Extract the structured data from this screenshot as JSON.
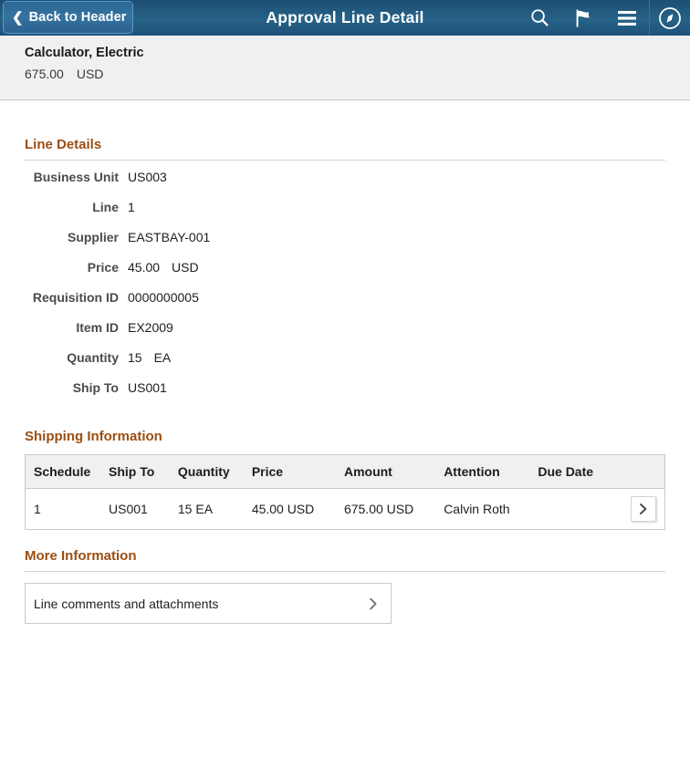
{
  "appbar": {
    "back_label": "Back to Header",
    "back_chevron": "chevron-left-icon",
    "title": "Approval Line Detail",
    "icons": [
      {
        "name": "search-icon",
        "label": "Search"
      },
      {
        "name": "flag-icon",
        "label": "Notifications"
      },
      {
        "name": "hamburger-menu-icon",
        "label": "Actions Menu"
      },
      {
        "name": "nav-compass-icon",
        "label": "NavBar"
      }
    ]
  },
  "subheader": {
    "item_title": "Calculator, Electric",
    "amount": "675.00",
    "currency": "USD"
  },
  "line_details": {
    "heading": "Line Details",
    "fields": [
      {
        "label": "Business Unit",
        "value": "US003",
        "unit": ""
      },
      {
        "label": "Line",
        "value": "1",
        "unit": ""
      },
      {
        "label": "Supplier",
        "value": "EASTBAY-001",
        "unit": ""
      },
      {
        "label": "Price",
        "value": "45.00",
        "unit": "USD"
      },
      {
        "label": "Requisition ID",
        "value": "0000000005",
        "unit": ""
      },
      {
        "label": "Item ID",
        "value": "EX2009",
        "unit": ""
      },
      {
        "label": "Quantity",
        "value": "15",
        "unit": "EA"
      },
      {
        "label": "Ship To",
        "value": "US001",
        "unit": ""
      }
    ]
  },
  "shipping_information": {
    "heading": "Shipping Information",
    "columns": [
      "Schedule",
      "Ship To",
      "Quantity",
      "Price",
      "Amount",
      "Attention",
      "Due Date",
      ""
    ],
    "rows": [
      {
        "schedule": "1",
        "ship_to": "US001",
        "quantity": "15 EA",
        "price": "45.00 USD",
        "amount": "675.00 USD",
        "attention": "Calvin Roth",
        "due_date": "",
        "detail_icon": "chevron-right-icon"
      }
    ]
  },
  "more_information": {
    "heading": "More Information",
    "items": [
      {
        "label": "Line comments and attachments",
        "chevron": "chevron-right-icon"
      }
    ]
  },
  "colors": {
    "appbar_top": "#1d4f72",
    "appbar_mid": "#276288",
    "section_heading": "#9c4e12",
    "subheader_bg": "#f0f0f0",
    "border": "#c9c9c9",
    "label_text": "#4b4b4b"
  }
}
